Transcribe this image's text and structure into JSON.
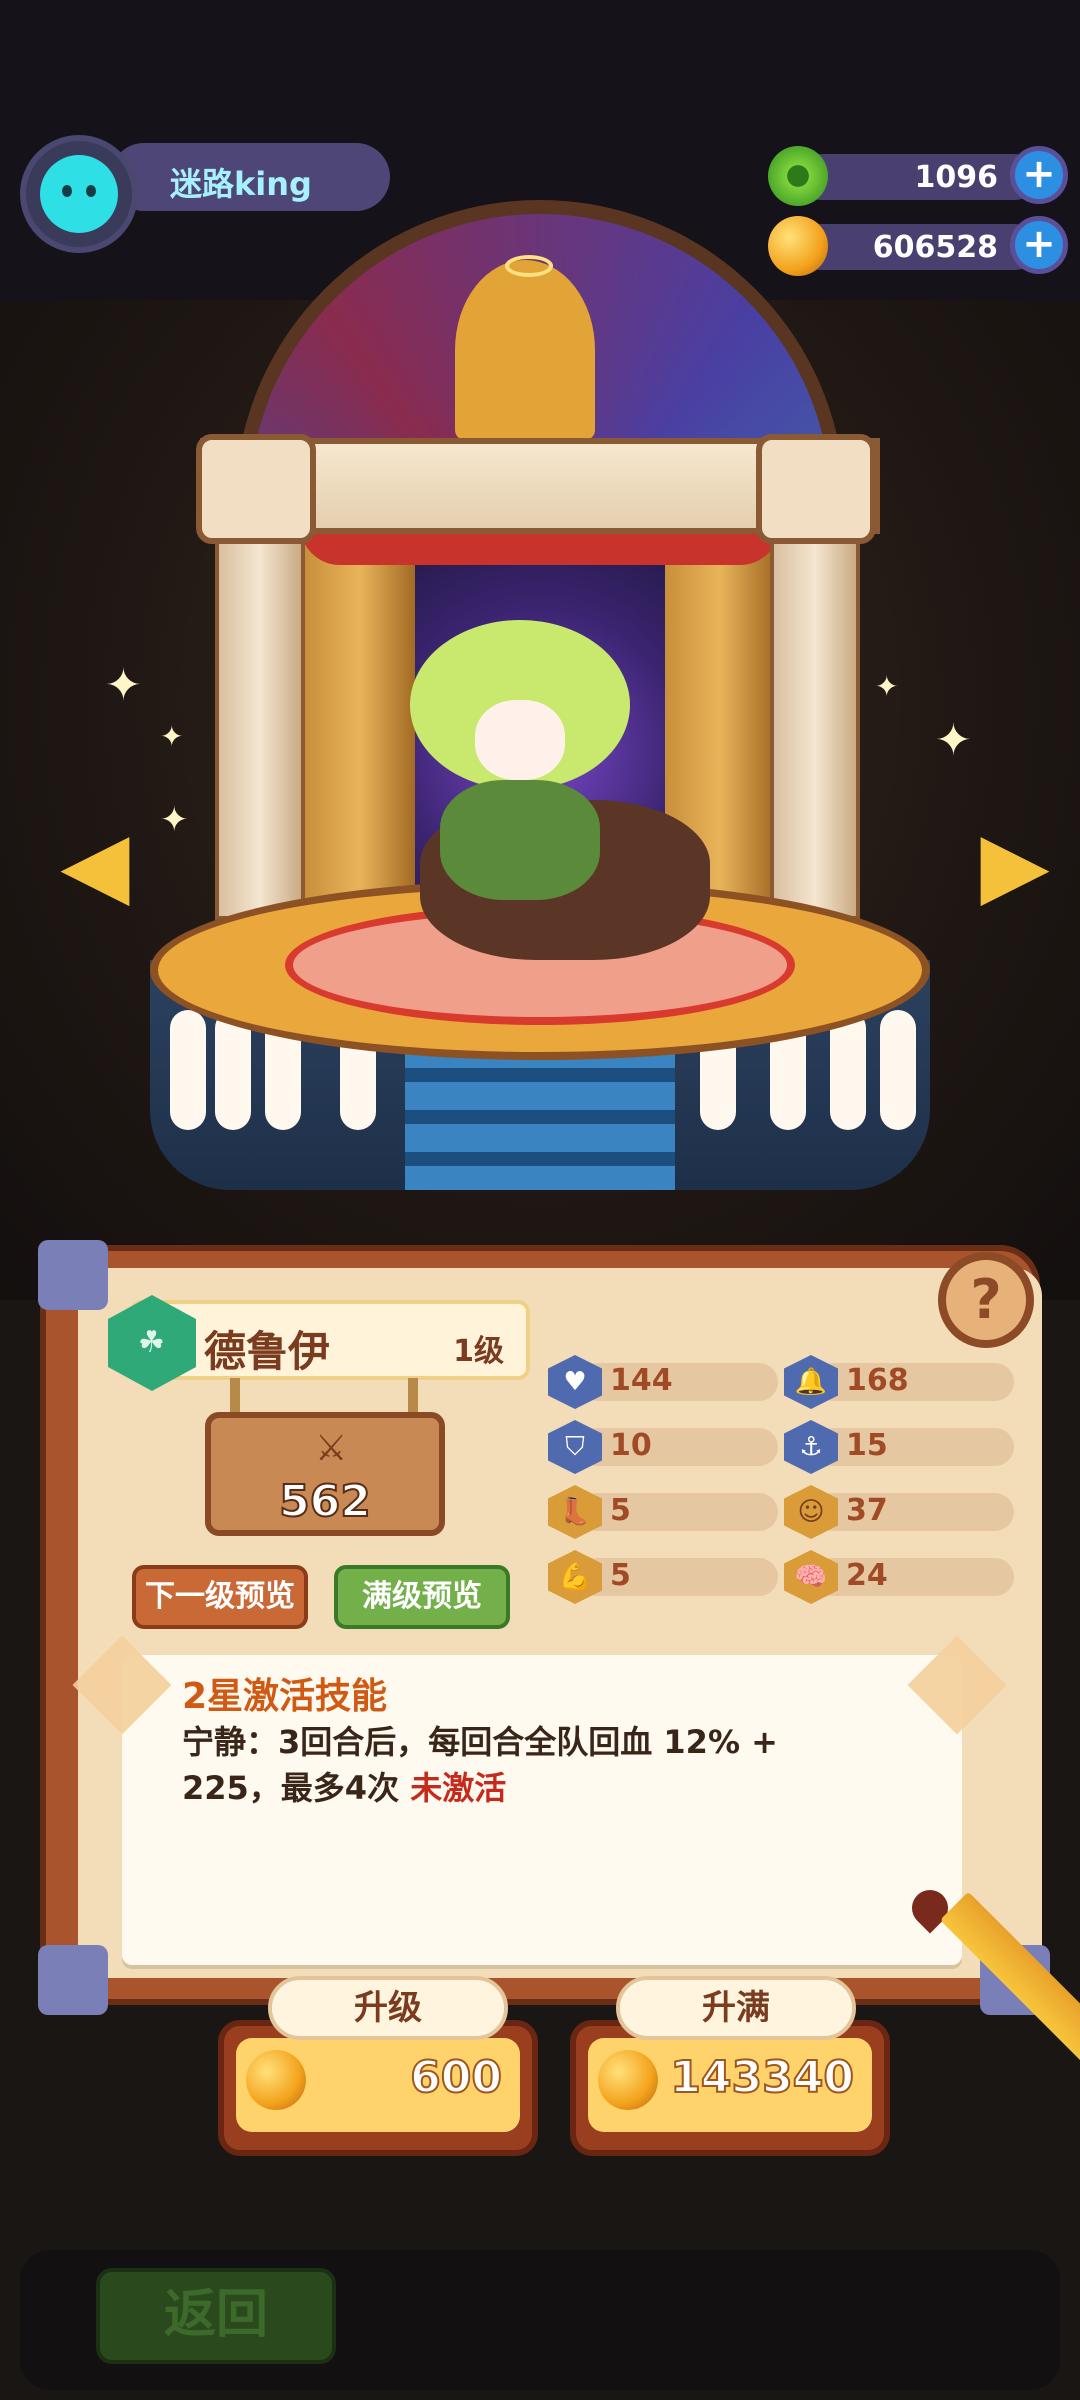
{
  "profile": {
    "username": "迷路king",
    "avatar_icon": "cat-avatar-icon"
  },
  "currencies": [
    {
      "name": "gem",
      "icon": "green-gem-icon",
      "value": "1096"
    },
    {
      "name": "coin",
      "icon": "gold-planet-coin-icon",
      "value": "606528"
    }
  ],
  "hero": {
    "name": "德鲁伊",
    "level": "1级",
    "power": "562",
    "class_icon": "druid-class-icon"
  },
  "buttons": {
    "next_level_preview": "下一级预览",
    "max_level_preview": "满级预览",
    "help": "?"
  },
  "stats": [
    {
      "icon": "heart-shield-icon",
      "value": "144"
    },
    {
      "icon": "bell-icon",
      "value": "168"
    },
    {
      "icon": "shield-icon",
      "value": "10"
    },
    {
      "icon": "anchor-icon",
      "value": "15"
    },
    {
      "icon": "boot-icon",
      "value": "5"
    },
    {
      "icon": "smile-icon",
      "value": "37"
    },
    {
      "icon": "muscle-icon",
      "value": "5"
    },
    {
      "icon": "brain-icon",
      "value": "24"
    }
  ],
  "skill": {
    "title": "2星激活技能",
    "description": "宁静：3回合后，每回合全队回血 12% + 225，最多4次",
    "status": "未激活"
  },
  "upgrade": {
    "label": "升级",
    "cost": "600"
  },
  "upgrade_max": {
    "label": "升满",
    "cost": "143340"
  },
  "back": {
    "label": "返回"
  }
}
